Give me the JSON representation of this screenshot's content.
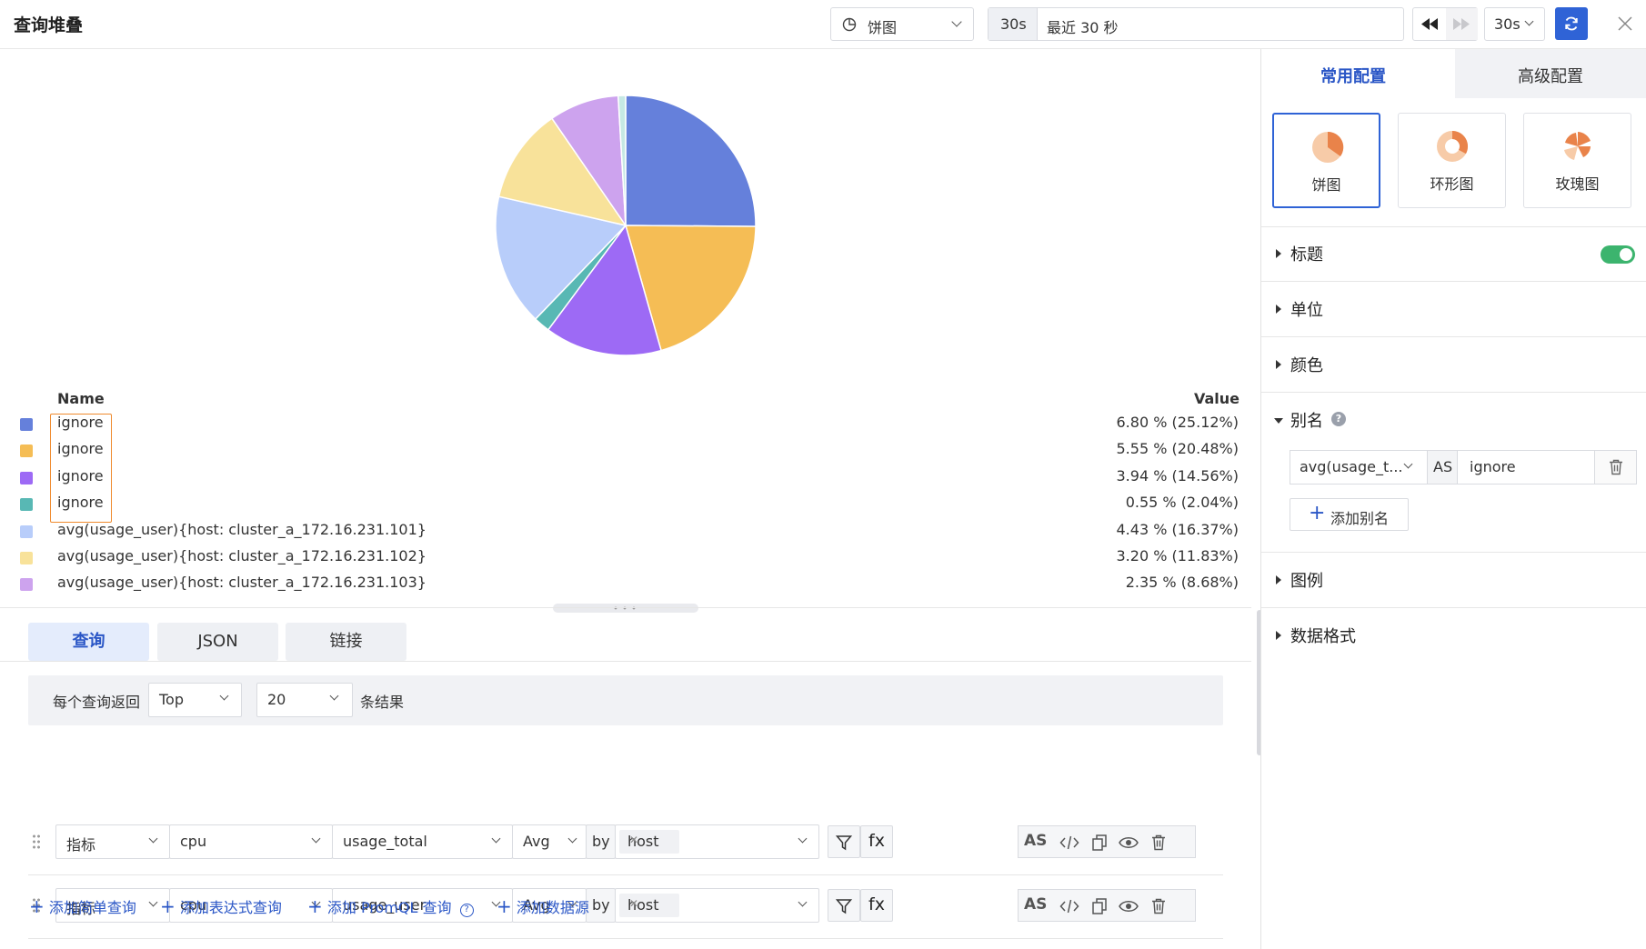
{
  "header": {
    "title": "查询堆叠",
    "chart_type": "饼图",
    "time_short": "30s",
    "time_range": "最近 30 秒",
    "refresh_interval": "30s"
  },
  "legend": {
    "name_header": "Name",
    "value_header": "Value",
    "rows": [
      {
        "name": "ignore",
        "value": "6.80 % (25.12%)",
        "color": "#6580db"
      },
      {
        "name": "ignore",
        "value": "5.55 % (20.48%)",
        "color": "#f5bd55"
      },
      {
        "name": "ignore",
        "value": "3.94 % (14.56%)",
        "color": "#9d6af5"
      },
      {
        "name": "ignore",
        "value": "0.55 % (2.04%)",
        "color": "#58b8b4"
      },
      {
        "name": "avg(usage_user){host: cluster_a_172.16.231.101}",
        "value": "4.43 % (16.37%)",
        "color": "#b8cdfa"
      },
      {
        "name": "avg(usage_user){host: cluster_a_172.16.231.102}",
        "value": "3.20 % (11.83%)",
        "color": "#f8e29a"
      },
      {
        "name": "avg(usage_user){host: cluster_a_172.16.231.103}",
        "value": "2.35 % (8.68%)",
        "color": "#cda3ee"
      }
    ]
  },
  "chart_data": {
    "type": "pie",
    "categories": [
      "ignore",
      "ignore",
      "ignore",
      "ignore",
      "avg(usage_user){host: cluster_a_172.16.231.101}",
      "avg(usage_user){host: cluster_a_172.16.231.102}",
      "avg(usage_user){host: cluster_a_172.16.231.103}",
      ""
    ],
    "values": [
      25.12,
      20.48,
      14.56,
      2.04,
      16.37,
      11.83,
      8.68,
      0.92
    ],
    "colors": [
      "#6580db",
      "#f5bd55",
      "#9d6af5",
      "#58b8b4",
      "#b8cdfa",
      "#f8e29a",
      "#cda3ee",
      "#c6e8e4"
    ]
  },
  "tabs": [
    "查询",
    "JSON",
    "链接"
  ],
  "query_options": {
    "prefix": "每个查询返回",
    "order": "Top",
    "limit": "20",
    "suffix": "条结果"
  },
  "queries": [
    {
      "type": "指标",
      "measurement": "cpu",
      "field": "usage_total",
      "agg": "Avg",
      "by": "by",
      "group_tag": "host"
    },
    {
      "type": "指标",
      "measurement": "cpu",
      "field": "usage_user",
      "agg": "Avg",
      "by": "by",
      "group_tag": "host"
    }
  ],
  "query_buttons": {
    "fx": "fx",
    "as": "AS"
  },
  "add_links": [
    "添加简单查询",
    "添加表达式查询",
    "添加 PromQL 查询",
    "添加数据源"
  ],
  "settings": {
    "tabs": [
      "常用配置",
      "高级配置"
    ],
    "chart_types": [
      "饼图",
      "环形图",
      "玫瑰图"
    ],
    "sections": [
      "标题",
      "单位",
      "颜色",
      "别名",
      "图例",
      "数据格式"
    ],
    "title_toggle_on": true,
    "alias": {
      "select": "avg(usage_t...",
      "as": "AS",
      "value": "ignore",
      "add": "添加别名"
    }
  }
}
